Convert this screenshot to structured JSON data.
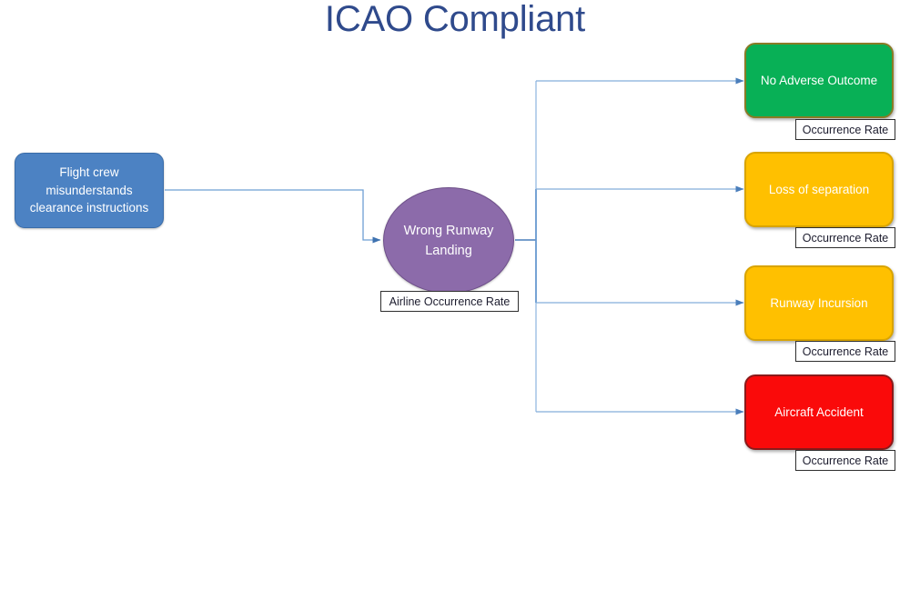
{
  "title": "ICAO Compliant",
  "theme": {
    "title_color": "#2F4A8C",
    "cause_fill": "#4C82C3",
    "cause_border": "#3A6CA8",
    "event_fill": "#8C6BAA",
    "event_border": "#6E5089",
    "connector_color": "#7BA7D7",
    "connector_color_strong": "#4A7EBB",
    "label_border": "#2E2E2E",
    "label_bg": "#FFFFFF",
    "label_text": "#1C1C2E"
  },
  "cause": {
    "label": "Flight crew misunderstands clearance instructions"
  },
  "event": {
    "label": "Wrong Runway Landing",
    "rate_label": "Airline Occurrence Rate"
  },
  "outcomes": [
    {
      "label": "No Adverse Outcome",
      "fill": "#08B056",
      "border": "#8A7B26",
      "text_color": "#FFFFFF",
      "rate_label": "Occurrence Rate"
    },
    {
      "label": "Loss of separation",
      "fill": "#FFC000",
      "border": "#D9A400",
      "text_color": "#FFFFFF",
      "rate_label": "Occurrence Rate"
    },
    {
      "label": "Runway Incursion",
      "fill": "#FFC000",
      "border": "#D9A400",
      "text_color": "#FFFFFF",
      "rate_label": "Occurrence Rate"
    },
    {
      "label": "Aircraft Accident",
      "fill": "#FA0A0A",
      "border": "#8B1A1A",
      "text_color": "#FFFFFF",
      "rate_label": "Occurrence Rate"
    }
  ]
}
